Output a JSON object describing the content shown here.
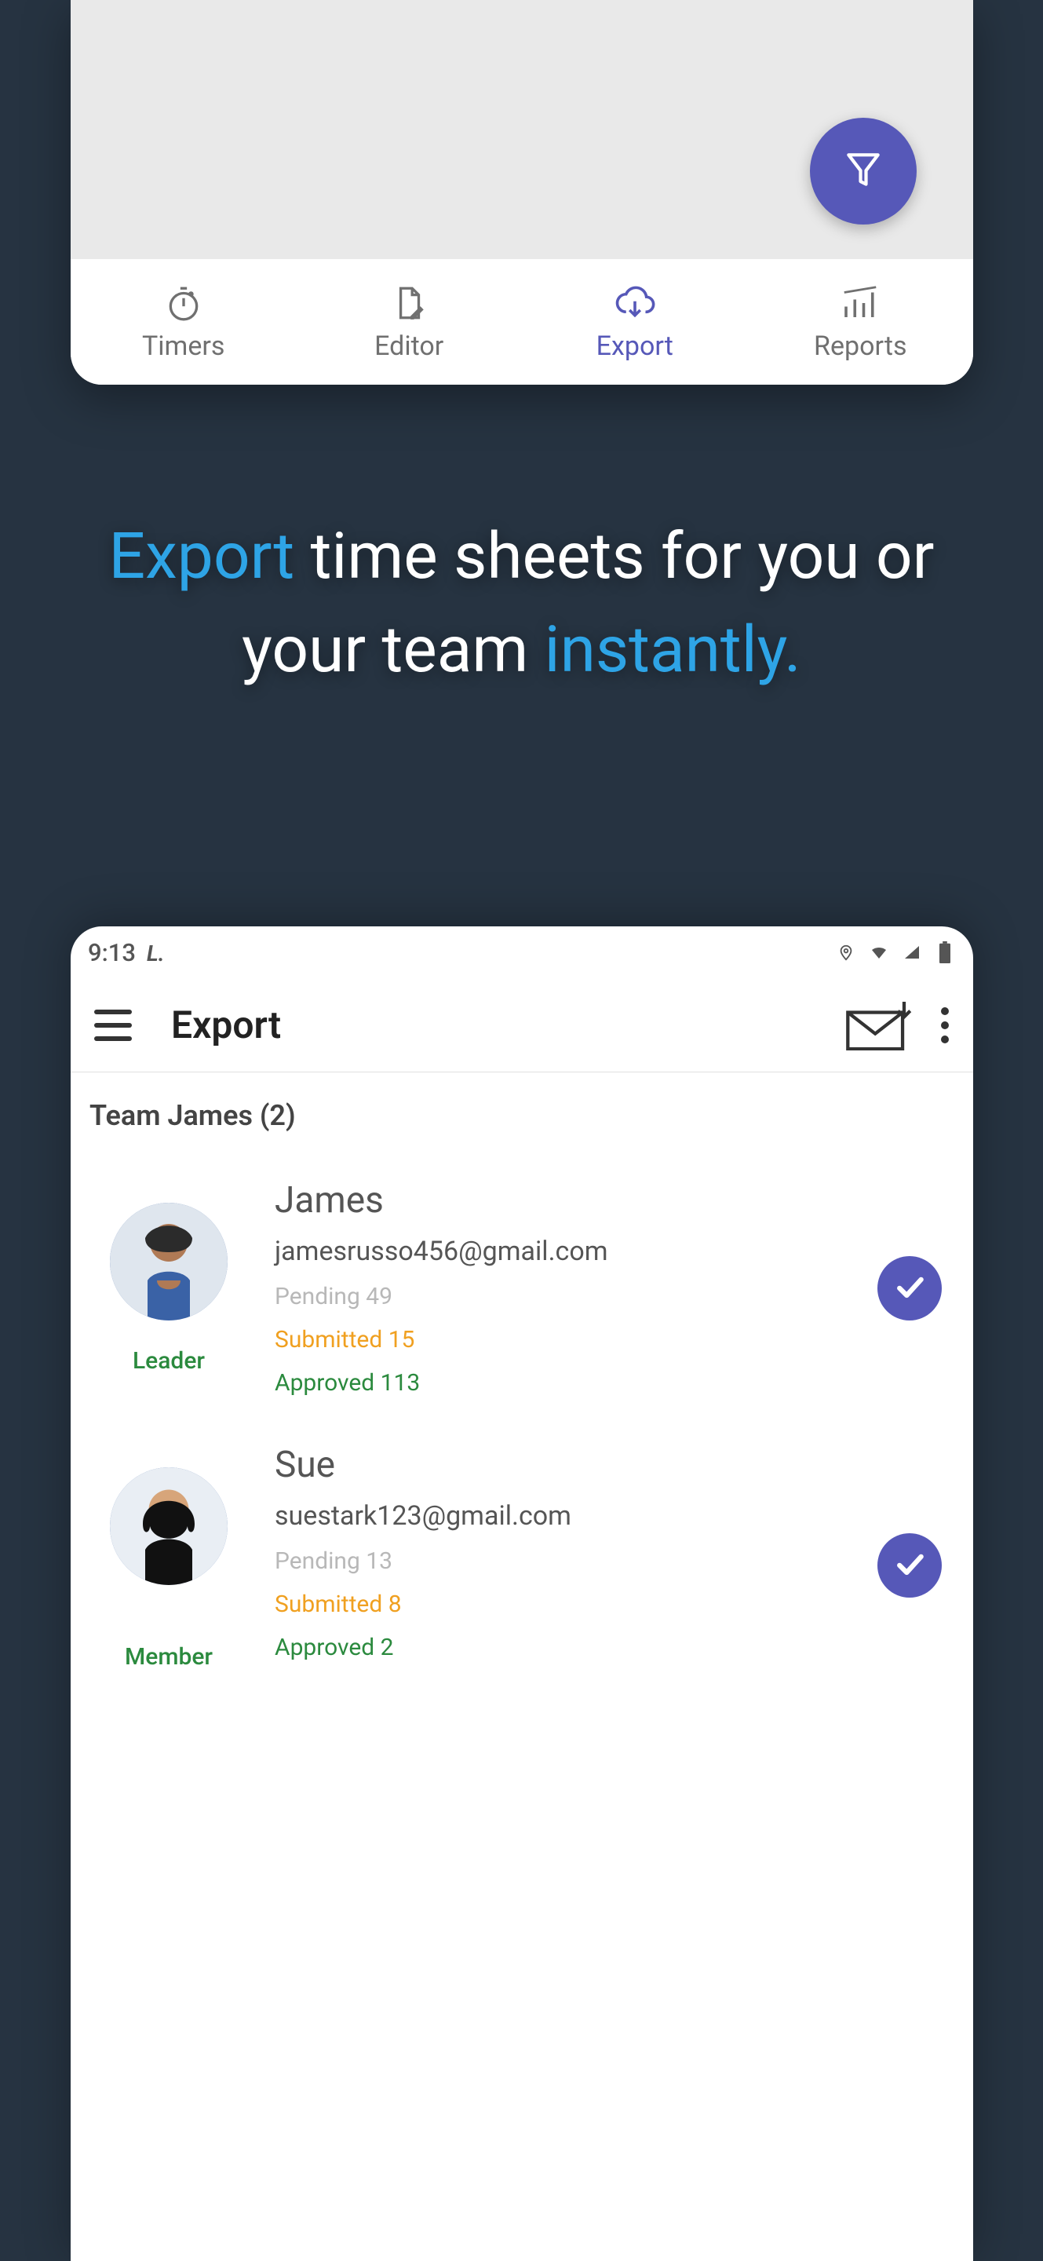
{
  "top_phone": {
    "tabs": [
      {
        "label": "Timers",
        "icon": "stopwatch-icon",
        "active": false
      },
      {
        "label": "Editor",
        "icon": "document-edit-icon",
        "active": false
      },
      {
        "label": "Export",
        "icon": "cloud-download-icon",
        "active": true
      },
      {
        "label": "Reports",
        "icon": "bar-chart-icon",
        "active": false
      }
    ],
    "fab_icon": "funnel-icon"
  },
  "headline": {
    "part1": "Export",
    "part2": " time sheets for you or your team ",
    "part3": "instantly."
  },
  "bottom_phone": {
    "statusbar": {
      "time": "9:13",
      "app_indicator": "L.",
      "icons": [
        "location-icon",
        "wifi-icon",
        "cell-signal-icon",
        "battery-icon"
      ]
    },
    "appbar": {
      "title": "Export",
      "menu_icon": "hamburger-icon",
      "mail_icon": "mail-download-icon",
      "overflow_icon": "kebab-icon"
    },
    "team": {
      "title": "Team James  (2)",
      "members": [
        {
          "name": "James",
          "email": "jamesrusso456@gmail.com",
          "role": "Leader",
          "role_class": "leader",
          "pending": "Pending 49",
          "submitted": "Submitted 15",
          "approved": "Approved 113",
          "selected": true
        },
        {
          "name": "Sue",
          "email": "suestark123@gmail.com",
          "role": "Member",
          "role_class": "member",
          "pending": "Pending 13",
          "submitted": "Submitted 8",
          "approved": "Approved 2",
          "selected": true
        }
      ]
    }
  }
}
